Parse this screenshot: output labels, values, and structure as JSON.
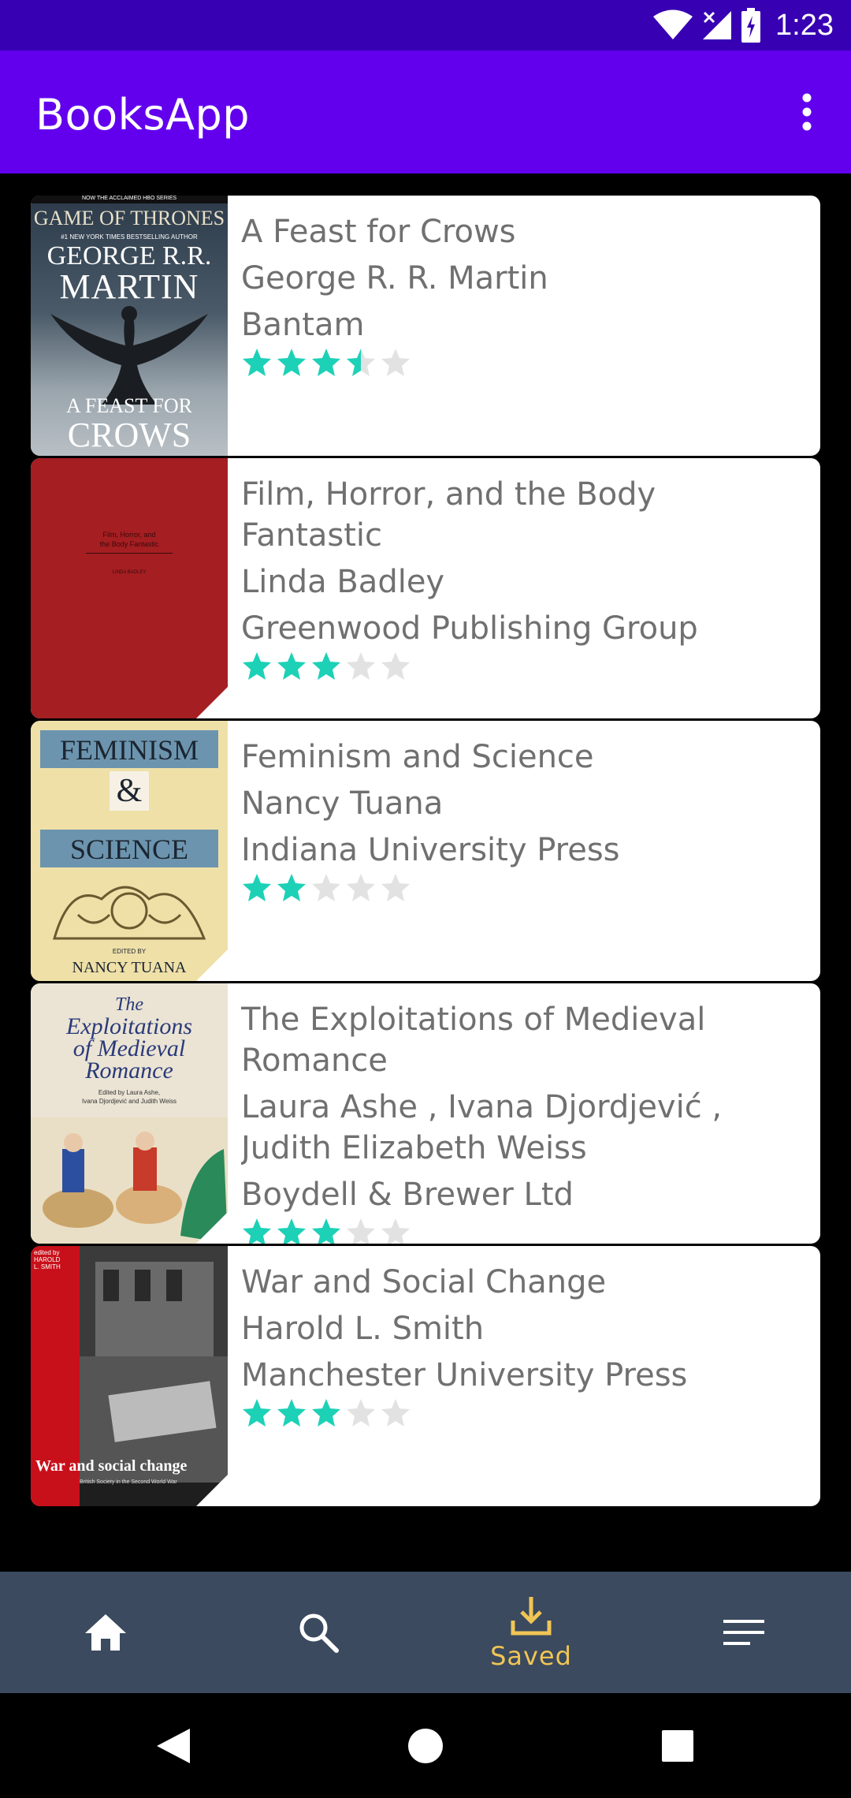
{
  "status_bar": {
    "time": "1:23",
    "icons": [
      "wifi-icon",
      "signal-icon",
      "battery-icon"
    ]
  },
  "app_bar": {
    "title": "BooksApp",
    "menu_icon": "more-vert-icon"
  },
  "colors": {
    "status_bar": "#3700b3",
    "app_bar": "#6200ee",
    "star_on": "#1dd1b7",
    "star_off": "#e2e2e2",
    "nav_bg": "#3b4a5e",
    "nav_active": "#f1c555"
  },
  "books": [
    {
      "title": "A Feast for Crows",
      "authors": "George R. R. Martin",
      "publisher": "Bantam",
      "rating": 3.5,
      "cover_text": [
        "NOW THE ACCLAIMED HBO SERIES",
        "GAME OF THRONES",
        "#1 NEW YORK TIMES BESTSELLING AUTHOR",
        "GEORGE R.R.",
        "MARTIN",
        "A FEAST FOR",
        "CROWS"
      ]
    },
    {
      "title": "Film, Horror, and the Body Fantastic",
      "authors": "Linda Badley",
      "publisher": "Greenwood Publishing Group",
      "rating": 3,
      "cover_text": [
        "Film, Horror, and",
        "the Body Fantastic",
        "LINDA BADLEY"
      ]
    },
    {
      "title": "Feminism and Science",
      "authors": "Nancy Tuana",
      "publisher": "Indiana University Press",
      "rating": 2,
      "cover_text": [
        "FEMINISM",
        "&",
        "SCIENCE",
        "EDITED BY",
        "NANCY TUANA"
      ]
    },
    {
      "title": "The Exploitations of Medieval Romance",
      "authors": "Laura Ashe , Ivana Djordjević , Judith Elizabeth Weiss",
      "publisher": "Boydell & Brewer Ltd",
      "rating": 3,
      "cover_text": [
        "The",
        "Exploitations",
        "of Medieval",
        "Romance",
        "Edited by Laura Ashe,",
        "Ivana Djordjević and Judith Weiss"
      ]
    },
    {
      "title": "War and Social Change",
      "authors": "Harold L. Smith",
      "publisher": "Manchester University Press",
      "rating": 3,
      "cover_text": [
        "edited by",
        "HAROLD",
        "L. SMITH",
        "War and social change",
        "British Society in the Second World War"
      ]
    }
  ],
  "bottom_nav": {
    "items": [
      {
        "icon": "home-icon",
        "label": ""
      },
      {
        "icon": "search-icon",
        "label": ""
      },
      {
        "icon": "download-icon",
        "label": "Saved"
      },
      {
        "icon": "menu-icon",
        "label": ""
      }
    ],
    "active_index": 2
  },
  "system_nav": [
    "back-icon",
    "home-circle-icon",
    "recents-icon"
  ]
}
